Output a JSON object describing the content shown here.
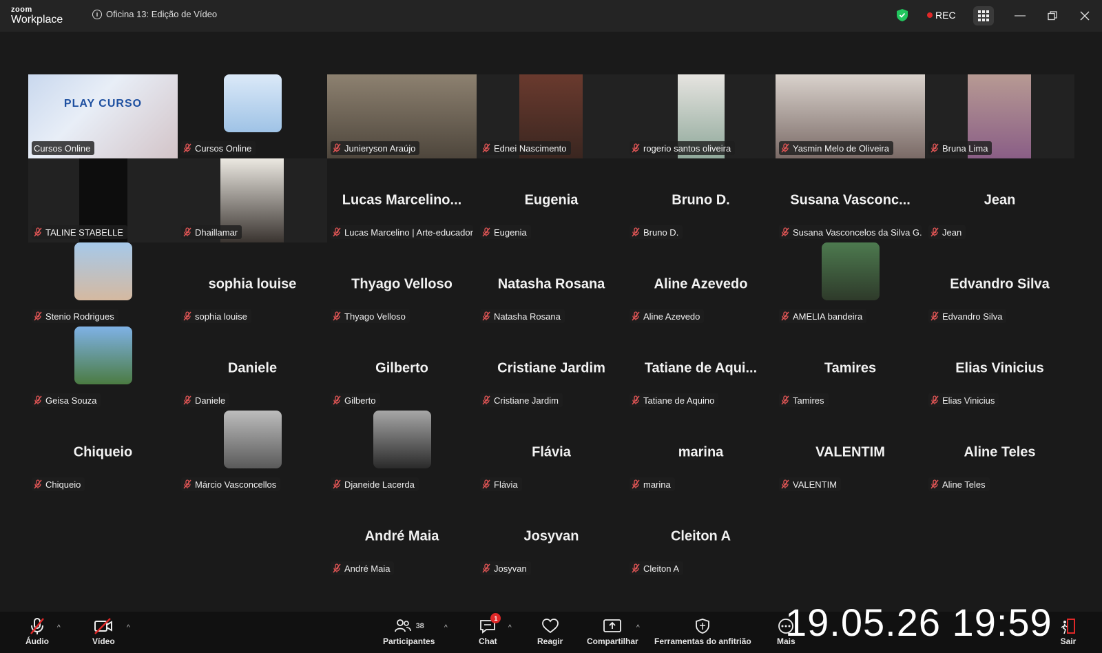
{
  "app": {
    "brand_top": "zoom",
    "brand_bottom": "Workplace",
    "meeting_title": "Oficina 13: Edição de Vídeo",
    "rec_label": "REC"
  },
  "colors": {
    "accent_active": "#29d366",
    "rec": "#e02828",
    "shield": "#22c55e",
    "mute": "#e05555"
  },
  "tiles": [
    {
      "name": "Cursos Online",
      "type": "video",
      "active": true,
      "muted": false,
      "banner": "PLAY CURSO"
    },
    {
      "name": "Cursos Online",
      "type": "avatar",
      "muted": true
    },
    {
      "name": "Junieryson Araújo",
      "type": "video",
      "muted": true
    },
    {
      "name": "Ednei Nascimento",
      "type": "video",
      "muted": true
    },
    {
      "name": "rogerio santos oliveira",
      "type": "video",
      "muted": true
    },
    {
      "name": "Yasmin Melo de Oliveira",
      "type": "video",
      "muted": true
    },
    {
      "name": "Bruna Lima",
      "type": "video",
      "muted": true
    },
    {
      "name": "TALINE STABELLE",
      "type": "video",
      "muted": true
    },
    {
      "name": "Dhaillamar",
      "type": "video",
      "muted": true
    },
    {
      "name": "Lucas Marcelino | Arte-educador",
      "display": "Lucas  Marcelino...",
      "type": "name",
      "muted": true
    },
    {
      "name": "Eugenia",
      "display": "Eugenia",
      "type": "name",
      "muted": true
    },
    {
      "name": "Bruno D.",
      "display": "Bruno D.",
      "type": "name",
      "muted": true
    },
    {
      "name": "Susana Vasconcelos da Silva G...",
      "display": "Susana  Vasconc...",
      "type": "name",
      "muted": true
    },
    {
      "name": "Jean",
      "display": "Jean",
      "type": "name",
      "muted": true
    },
    {
      "name": "Stenio Rodrigues",
      "type": "avatar",
      "muted": true
    },
    {
      "name": "sophia louise",
      "display": "sophia louise",
      "type": "name",
      "muted": true
    },
    {
      "name": "Thyago Velloso",
      "display": "Thyago Velloso",
      "type": "name",
      "muted": true
    },
    {
      "name": "Natasha Rosana",
      "display": "Natasha Rosana",
      "type": "name",
      "muted": true
    },
    {
      "name": "Aline Azevedo",
      "display": "Aline Azevedo",
      "type": "name",
      "muted": true
    },
    {
      "name": "AMELIA bandeira",
      "type": "avatar",
      "muted": true
    },
    {
      "name": "Edvandro Silva",
      "display": "Edvandro Silva",
      "type": "name",
      "muted": true
    },
    {
      "name": "Geisa Souza",
      "type": "avatar",
      "muted": true
    },
    {
      "name": "Daniele",
      "display": "Daniele",
      "type": "name",
      "muted": true
    },
    {
      "name": "Gilberto",
      "display": "Gilberto",
      "type": "name",
      "muted": true
    },
    {
      "name": "Cristiane Jardim",
      "display": "Cristiane Jardim",
      "type": "name",
      "muted": true
    },
    {
      "name": "Tatiane de Aquino",
      "display": "Tatiane  de  Aqui...",
      "type": "name",
      "muted": true
    },
    {
      "name": "Tamires",
      "display": "Tamires",
      "type": "name",
      "muted": true
    },
    {
      "name": "Elias Vinicius",
      "display": "Elias Vinicius",
      "type": "name",
      "muted": true
    },
    {
      "name": "Chiqueio",
      "display": "Chiqueio",
      "type": "name",
      "muted": true
    },
    {
      "name": "Márcio Vasconcellos",
      "type": "avatar",
      "muted": true
    },
    {
      "name": "Djaneide Lacerda",
      "type": "avatar",
      "muted": true
    },
    {
      "name": "Flávia",
      "display": "Flávia",
      "type": "name",
      "muted": true
    },
    {
      "name": "marina",
      "display": "marina",
      "type": "name",
      "muted": true
    },
    {
      "name": "VALENTIM",
      "display": "VALENTIM",
      "type": "name",
      "muted": true
    },
    {
      "name": "Aline Teles",
      "display": "Aline Teles",
      "type": "name",
      "muted": true
    },
    {
      "name": "André Maia",
      "display": "André Maia",
      "type": "name",
      "muted": true
    },
    {
      "name": "Josyvan",
      "display": "Josyvan",
      "type": "name",
      "muted": true
    },
    {
      "name": "Cleiton A",
      "display": "Cleiton A",
      "type": "name",
      "muted": true
    }
  ],
  "toolbar": {
    "audio": "Áudio",
    "video": "Vídeo",
    "participants": "Participantes",
    "participants_count": "38",
    "chat": "Chat",
    "chat_badge": "1",
    "react": "Reagir",
    "share": "Compartilhar",
    "host_tools": "Ferramentas do anfitrião",
    "more": "Mais",
    "leave": "Sair"
  },
  "clock": "19.05.26 19:59"
}
